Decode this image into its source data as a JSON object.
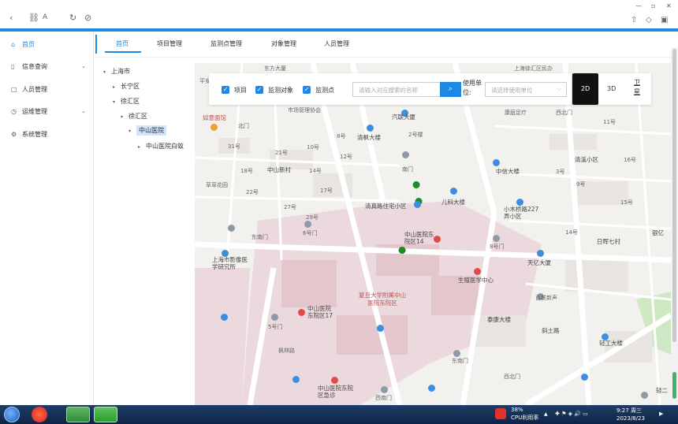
{
  "nav": {
    "items": [
      {
        "label": "首页",
        "icon": "home-icon",
        "active": true,
        "expandable": false
      },
      {
        "label": "信息查询",
        "icon": "document-icon",
        "active": false,
        "expandable": true
      },
      {
        "label": "人员管理",
        "icon": "square-icon",
        "active": false,
        "expandable": false
      },
      {
        "label": "运维管理",
        "icon": "clock-icon",
        "active": false,
        "expandable": true
      },
      {
        "label": "系统管理",
        "icon": "gear-icon",
        "active": false,
        "expandable": false
      }
    ]
  },
  "tabs": [
    "首页",
    "项目管理",
    "监测点管理",
    "对象管理",
    "人员管理"
  ],
  "tree": {
    "nodes": [
      {
        "label": "上海市",
        "caret": "▾"
      },
      {
        "label": "长宁区",
        "caret": "▸"
      },
      {
        "label": "徐汇区",
        "caret": "▾"
      },
      {
        "label": "徐汇区",
        "caret": "▾"
      },
      {
        "label": "中山医院",
        "caret": "▾"
      },
      {
        "label": "中山医院白蚁",
        "caret": "▸"
      }
    ]
  },
  "filter": {
    "checkboxes": [
      "项目",
      "监测对象",
      "监测点"
    ],
    "search_placeholder": "请输入对应搜索的名称",
    "unit_label": "使用单位:",
    "unit_placeholder": "请选择使用单位"
  },
  "view": {
    "mode_2d": "2D",
    "mode_3d": "3D",
    "satellite": "卫星"
  },
  "map_labels": {
    "places": [
      "平安",
      "东方大厦",
      "上海徐汇区民办",
      "市场管理协会",
      "如意面馆",
      "汽联大厦",
      "康庭足疗",
      "西北门",
      "北门",
      "清枫大楼",
      "2号楼",
      "11号",
      "31号",
      "8号",
      "中信大楼",
      "21号",
      "10号",
      "12号",
      "南门",
      "清溪小区",
      "16号",
      "18号",
      "中山新村",
      "14号",
      "3号",
      "草草花园",
      "22号",
      "17号",
      "9号",
      "27号",
      "清真路住宅小区",
      "儿科大楼",
      "小木桥路227弄小区",
      "29号",
      "15号",
      "银亿",
      "6号门",
      "东南门",
      "中山医院东院区14",
      "8号门",
      "14号",
      "日晖七村",
      "上海市影像医学研究所",
      "天亿大厦",
      "生殖医学中心",
      "复旦大学附属中山医院东院区",
      "中山医院东院区17",
      "百联新声",
      "泰康大楼",
      "5号门",
      "斜土路",
      "轻工大楼",
      "东南门",
      "枫林路",
      "西北门",
      "中山医院东院区急诊",
      "西南门",
      "轻二"
    ]
  },
  "taskbar": {
    "cpu_percent": "38%",
    "cpu_label": "CPU利用率",
    "time": "9:27 周三",
    "date": "2023/8/23"
  },
  "colors": {
    "accent": "#1e88e5",
    "selected_tree": "#cfe5fb",
    "marker": "#1f8a2b"
  }
}
